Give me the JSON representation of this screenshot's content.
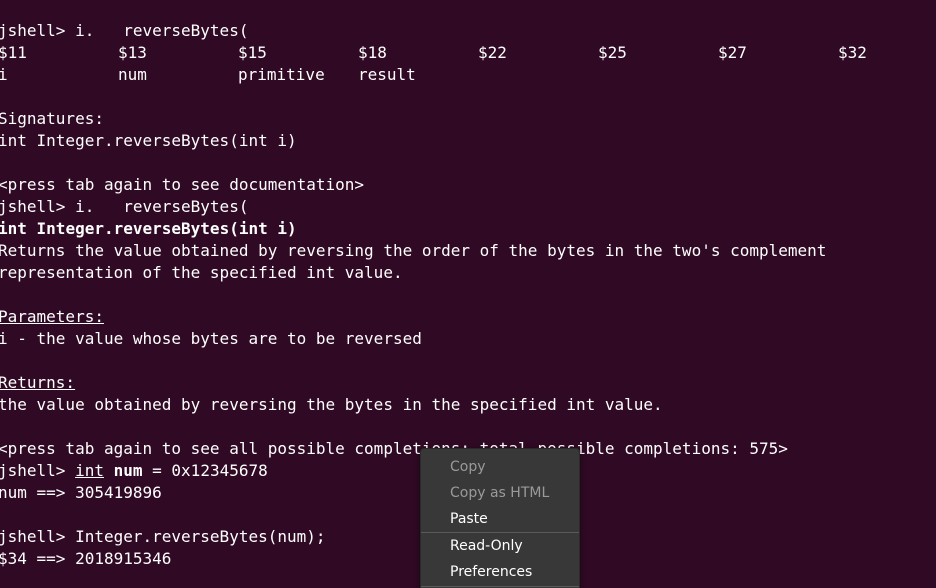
{
  "terminal": {
    "prompt": "jshell> ",
    "l1_rest": "i.   reverseBytes(",
    "completions_row1": [
      "$11",
      "$13",
      "$15",
      "$18",
      "$22",
      "$25",
      "$27",
      "$32"
    ],
    "completions_row2": [
      "i",
      "num",
      "primitive",
      "result"
    ],
    "signatures_header": "Signatures:",
    "signature_line": "int Integer.reverseBytes(int i)",
    "press_tab_docs": "<press tab again to see documentation>",
    "l2_rest": "i.   reverseBytes(",
    "sig_int": "int",
    "sig_bold_name": " Integer.reverseBytes(int i)",
    "doc_line1": "Returns the value obtained by reversing the order of the bytes in the two's complement",
    "doc_line2": "representation of the specified int value.",
    "params_header": "Parameters:",
    "params_line": "i - the value whose bytes are to be reversed",
    "returns_header": "Returns:",
    "returns_line": "the value obtained by reversing the bytes in the specified int value.",
    "press_tab_all": "<press tab again to see all possible completions; total possible completions: 575>",
    "cmd1_int": "int",
    "cmd1_num": "num",
    "cmd1_rest": " = 0x12345678",
    "out1": "num ==> 305419896",
    "cmd2": "Integer.reverseBytes(num);",
    "out2": "$34 ==> 2018915346"
  },
  "context_menu": {
    "copy": "Copy",
    "copy_html": "Copy as HTML",
    "paste": "Paste",
    "read_only": "Read-Only",
    "preferences": "Preferences"
  }
}
